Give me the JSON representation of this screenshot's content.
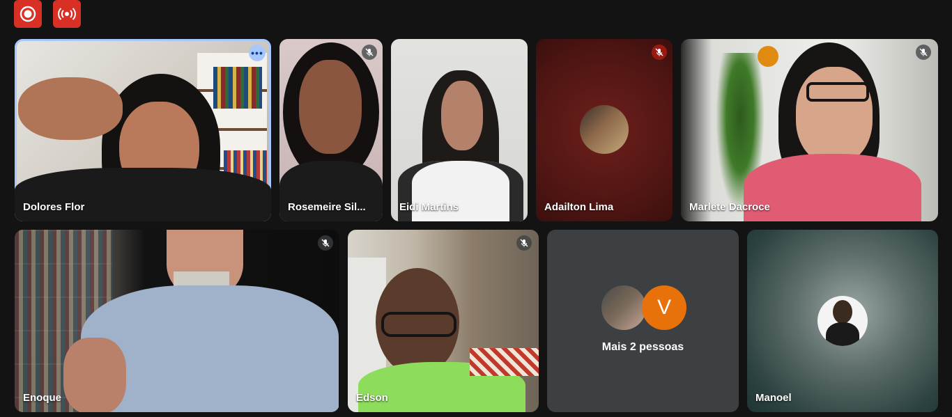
{
  "toolbar": {
    "record_icon": "record-icon",
    "broadcast_icon": "broadcast-icon",
    "color": "#d93025"
  },
  "participants": [
    {
      "name": "Dolores Flor",
      "active_speaker": true,
      "more_icon": "more-options-icon"
    },
    {
      "name": "Rosemeire Sil...",
      "muted": true
    },
    {
      "name": "Eidi Martins"
    },
    {
      "name": "Adailton Lima",
      "muted": true,
      "camera": "off"
    },
    {
      "name": "Marlete Dacroce",
      "muted": true
    },
    {
      "name": "Enoque",
      "muted": true
    },
    {
      "name": "Edson",
      "muted": true
    },
    {
      "name": "Manoel",
      "camera": "off"
    }
  ],
  "more_people": {
    "label": "Mais 2 pessoas",
    "avatar_letter": "V",
    "avatar_color": "#e8710a"
  },
  "colors": {
    "background": "#131313",
    "active_border": "#a8c7fa",
    "mic_off_red": "#9a1a12"
  }
}
